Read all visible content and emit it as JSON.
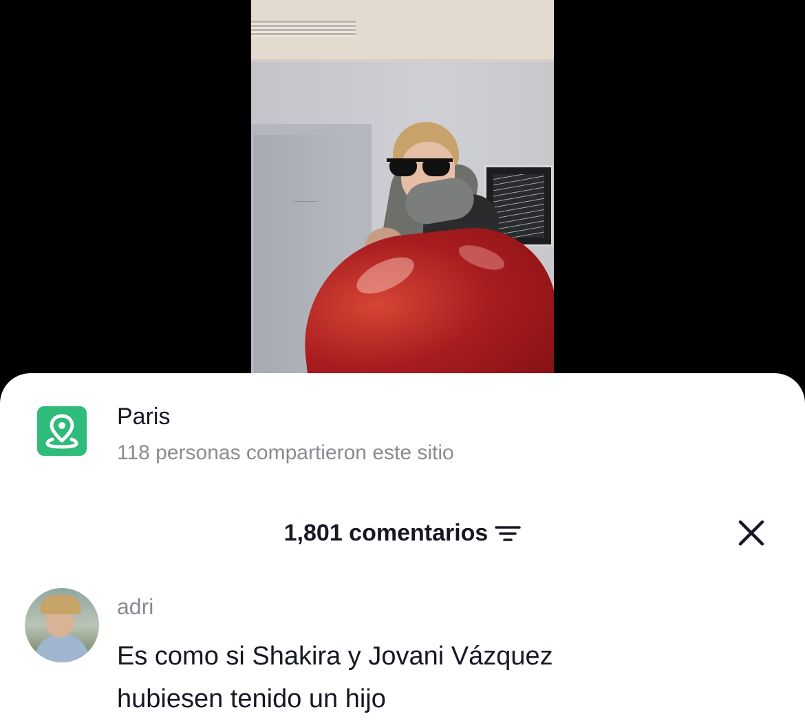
{
  "location": {
    "name": "Paris",
    "subtitle": "118 personas compartieron este sitio",
    "icon": "location-pin-icon",
    "icon_color": "#2fbb7a"
  },
  "comments_header": {
    "title": "1,801 comentarios",
    "filter_icon": "filter-lines-icon",
    "close_icon": "close-icon"
  },
  "comment": {
    "username": "adri",
    "text_line1": "Es como si Shakira y Jovani Vázquez",
    "text_line2": "hubiesen tenido un hijo"
  }
}
